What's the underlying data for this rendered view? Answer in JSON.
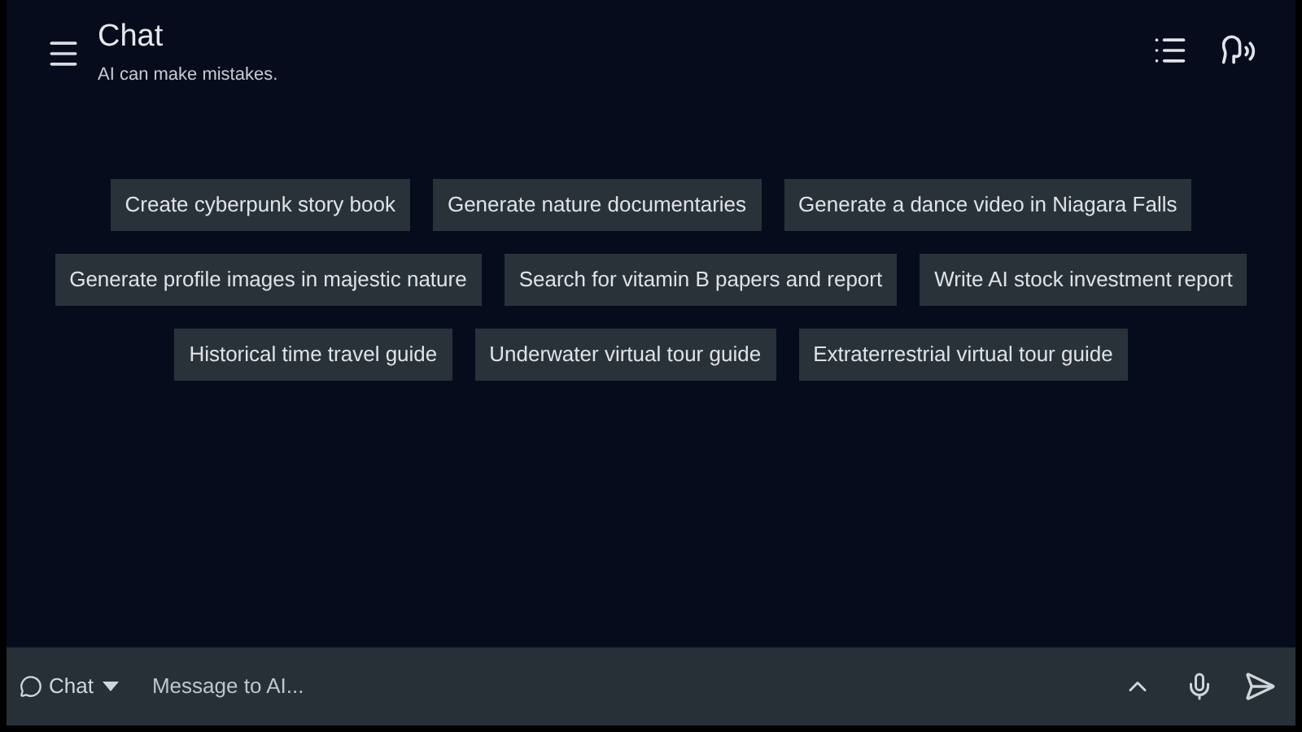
{
  "header": {
    "title": "Chat",
    "subtitle": "AI can make mistakes."
  },
  "suggestion_rows": [
    [
      "Create cyberpunk story book",
      "Generate nature documentaries",
      "Generate a dance video in Niagara Falls"
    ],
    [
      "Generate profile images in majestic nature",
      "Search for vitamin B papers and report",
      "Write AI stock investment report"
    ],
    [
      "Historical time travel guide",
      "Underwater virtual tour guide",
      "Extraterrestrial virtual tour guide"
    ]
  ],
  "composer": {
    "mode": "Chat",
    "placeholder": "Message to AI..."
  }
}
